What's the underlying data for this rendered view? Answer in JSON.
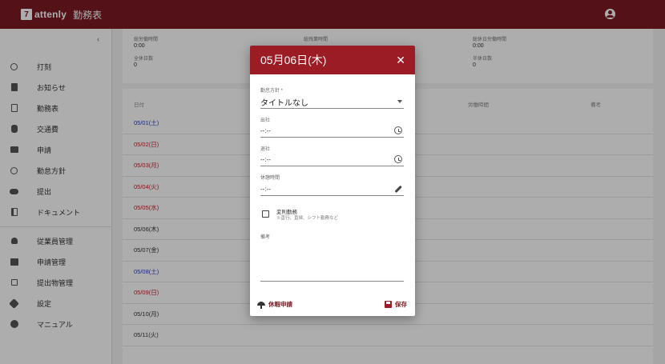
{
  "header": {
    "logo_mark": "7",
    "logo_text": "attenly",
    "title": "勤務表"
  },
  "sidebar": {
    "collapse_icon": "chevron-left",
    "items": [
      {
        "label": "打刻",
        "icon": "clock-icon"
      },
      {
        "label": "お知らせ",
        "icon": "clipboard-icon"
      },
      {
        "label": "勤務表",
        "icon": "calendar-icon"
      },
      {
        "label": "交通費",
        "icon": "train-icon"
      },
      {
        "label": "申請",
        "icon": "briefcase-icon"
      },
      {
        "label": "勤怠方針",
        "icon": "compass-icon"
      },
      {
        "label": "提出",
        "icon": "cloud-upload-icon"
      },
      {
        "label": "ドキュメント",
        "icon": "document-icon"
      },
      {
        "label": "従業員管理",
        "icon": "person-icon"
      },
      {
        "label": "申請管理",
        "icon": "badge-icon"
      },
      {
        "label": "提出物管理",
        "icon": "inbox-icon"
      },
      {
        "label": "設定",
        "icon": "gear-icon"
      },
      {
        "label": "マニュアル",
        "icon": "help-icon"
      }
    ]
  },
  "summary": {
    "work_time_label": "総労働時間",
    "work_time": "0:00",
    "absence_label": "全休日数",
    "absence": "0",
    "overtime_label": "総残業時間",
    "holiday_work_label": "総休日労働時間",
    "holiday_work": "0:00",
    "half_day_label": "半休日数",
    "half_day": "0"
  },
  "table": {
    "headers": {
      "date": "日付",
      "holiday_work": "労働時間",
      "note": "備考"
    },
    "rows": [
      {
        "date": "05/01(土)",
        "tone": "blue"
      },
      {
        "date": "05/02(日)",
        "tone": "red"
      },
      {
        "date": "05/03(月)",
        "tone": "red"
      },
      {
        "date": "05/04(火)",
        "tone": "red"
      },
      {
        "date": "05/05(水)",
        "tone": "red"
      },
      {
        "date": "05/06(木)",
        "tone": "black"
      },
      {
        "date": "05/07(金)",
        "tone": "black"
      },
      {
        "date": "05/08(土)",
        "tone": "blue"
      },
      {
        "date": "05/09(日)",
        "tone": "red"
      },
      {
        "date": "05/10(月)",
        "tone": "black"
      },
      {
        "date": "05/11(火)",
        "tone": "black"
      }
    ]
  },
  "dialog": {
    "title": "05月06日(木)",
    "close_icon": "close-icon",
    "policy_label": "勤怠方針 *",
    "policy_value": "タイトルなし",
    "clock_in_label": "出社",
    "clock_in_value": "--:--",
    "clock_out_label": "退社",
    "clock_out_value": "--:--",
    "break_label": "休憩時間",
    "break_value": "--:--",
    "irregular_label": "変則勤務",
    "irregular_sub": "※直行、直帰、シフト勤務など",
    "memo_label": "備考",
    "leave_button": "休暇申請",
    "save_button": "保存"
  },
  "colors": {
    "brand": "#7d1a22",
    "dialog_header": "#9c1c26",
    "weekend_blue": "#2a3fbf",
    "holiday_red": "#c0232d"
  }
}
